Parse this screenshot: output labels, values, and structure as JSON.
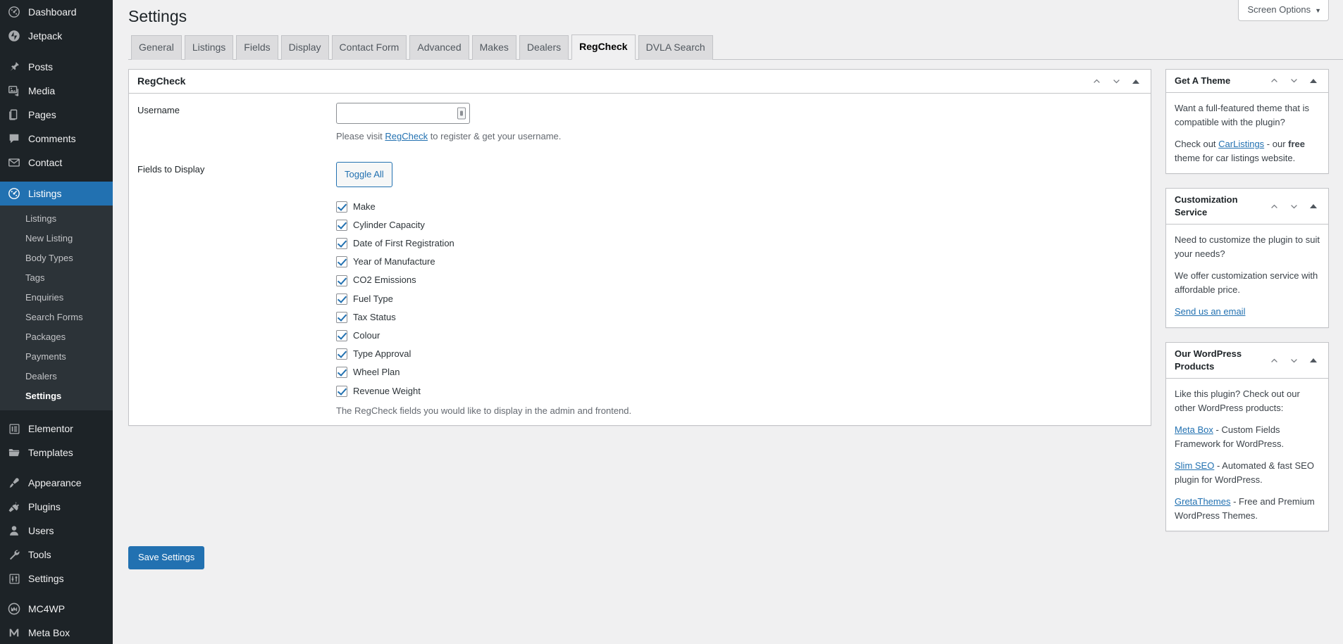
{
  "screen_options": {
    "label": "Screen Options",
    "caret": "▼"
  },
  "sidebar": {
    "top_items": [
      {
        "label": "Dashboard",
        "icon": "dashboard-icon",
        "current": false
      },
      {
        "label": "Jetpack",
        "icon": "jetpack-icon",
        "current": false
      },
      {
        "label": "Posts",
        "icon": "pin-icon",
        "current": false
      },
      {
        "label": "Media",
        "icon": "media-icon",
        "current": false
      },
      {
        "label": "Pages",
        "icon": "pages-icon",
        "current": false
      },
      {
        "label": "Comments",
        "icon": "comments-icon",
        "current": false
      },
      {
        "label": "Contact",
        "icon": "envelope-icon",
        "current": false
      },
      {
        "label": "Listings",
        "icon": "listings-icon",
        "current": true
      }
    ],
    "submenu": [
      {
        "label": "Listings",
        "current": false
      },
      {
        "label": "New Listing",
        "current": false
      },
      {
        "label": "Body Types",
        "current": false
      },
      {
        "label": "Tags",
        "current": false
      },
      {
        "label": "Enquiries",
        "current": false
      },
      {
        "label": "Search Forms",
        "current": false
      },
      {
        "label": "Packages",
        "current": false
      },
      {
        "label": "Payments",
        "current": false
      },
      {
        "label": "Dealers",
        "current": false
      },
      {
        "label": "Settings",
        "current": true
      }
    ],
    "group_two": [
      {
        "label": "Elementor",
        "icon": "elementor-icon"
      },
      {
        "label": "Templates",
        "icon": "folder-icon"
      }
    ],
    "group_three": [
      {
        "label": "Appearance",
        "icon": "brush-icon"
      },
      {
        "label": "Plugins",
        "icon": "plug-icon"
      },
      {
        "label": "Users",
        "icon": "user-icon"
      },
      {
        "label": "Tools",
        "icon": "wrench-icon"
      },
      {
        "label": "Settings",
        "icon": "sliders-icon"
      }
    ],
    "group_four": [
      {
        "label": "MC4WP",
        "icon": "mc4wp-icon"
      },
      {
        "label": "Meta Box",
        "icon": "metabox-icon"
      }
    ]
  },
  "header": {
    "title": "Settings"
  },
  "tabs": [
    {
      "label": "General",
      "active": false
    },
    {
      "label": "Listings",
      "active": false
    },
    {
      "label": "Fields",
      "active": false
    },
    {
      "label": "Display",
      "active": false
    },
    {
      "label": "Contact Form",
      "active": false
    },
    {
      "label": "Advanced",
      "active": false
    },
    {
      "label": "Makes",
      "active": false
    },
    {
      "label": "Dealers",
      "active": false
    },
    {
      "label": "RegCheck",
      "active": true
    },
    {
      "label": "DVLA Search",
      "active": false
    }
  ],
  "main_panel": {
    "title": "RegCheck",
    "username": {
      "label": "Username",
      "value": "",
      "placeholder": "",
      "desc_before": "Please visit ",
      "desc_link": "RegCheck",
      "desc_after": " to register & get your username."
    },
    "fields_to_display": {
      "label": "Fields to Display",
      "toggle_all_label": "Toggle All",
      "items": [
        {
          "label": "Make",
          "checked": true
        },
        {
          "label": "Cylinder Capacity",
          "checked": true
        },
        {
          "label": "Date of First Registration",
          "checked": true
        },
        {
          "label": "Year of Manufacture",
          "checked": true
        },
        {
          "label": "CO2 Emissions",
          "checked": true
        },
        {
          "label": "Fuel Type",
          "checked": true
        },
        {
          "label": "Tax Status",
          "checked": true
        },
        {
          "label": "Colour",
          "checked": true
        },
        {
          "label": "Type Approval",
          "checked": true
        },
        {
          "label": "Wheel Plan",
          "checked": true
        },
        {
          "label": "Revenue Weight",
          "checked": true
        }
      ],
      "description": "The RegCheck fields you would like to display in the admin and frontend."
    }
  },
  "submit": {
    "label": "Save Settings"
  },
  "side_boxes": [
    {
      "title": "Get A Theme",
      "paragraphs": [
        {
          "parts": [
            {
              "t": "Want a full-featured theme that is compatible with the plugin?",
              "k": "text"
            }
          ]
        },
        {
          "parts": [
            {
              "t": "Check out ",
              "k": "text"
            },
            {
              "t": "CarListings",
              "k": "link"
            },
            {
              "t": " - our ",
              "k": "text"
            },
            {
              "t": "free",
              "k": "bold"
            },
            {
              "t": " theme for car listings website.",
              "k": "text"
            }
          ]
        }
      ]
    },
    {
      "title": "Customization Service",
      "paragraphs": [
        {
          "parts": [
            {
              "t": "Need to customize the plugin to suit your needs?",
              "k": "text"
            }
          ]
        },
        {
          "parts": [
            {
              "t": "We offer customization service with affordable price.",
              "k": "text"
            }
          ]
        },
        {
          "parts": [
            {
              "t": "Send us an email",
              "k": "link"
            }
          ]
        }
      ]
    },
    {
      "title": "Our WordPress Products",
      "paragraphs": [
        {
          "parts": [
            {
              "t": "Like this plugin? Check out our other WordPress products:",
              "k": "text"
            }
          ]
        },
        {
          "parts": [
            {
              "t": "Meta Box",
              "k": "link"
            },
            {
              "t": " - Custom Fields Framework for WordPress.",
              "k": "text"
            }
          ]
        },
        {
          "parts": [
            {
              "t": "Slim SEO",
              "k": "link"
            },
            {
              "t": " - Automated & fast SEO plugin for WordPress.",
              "k": "text"
            }
          ]
        },
        {
          "parts": [
            {
              "t": "GretaThemes",
              "k": "link"
            },
            {
              "t": " - Free and Premium WordPress Themes.",
              "k": "text"
            }
          ]
        }
      ]
    }
  ],
  "colors": {
    "accent": "#2271b1",
    "sidebar_bg": "#1d2327",
    "submenu_bg": "#2c3338",
    "page_bg": "#f0f0f1"
  }
}
